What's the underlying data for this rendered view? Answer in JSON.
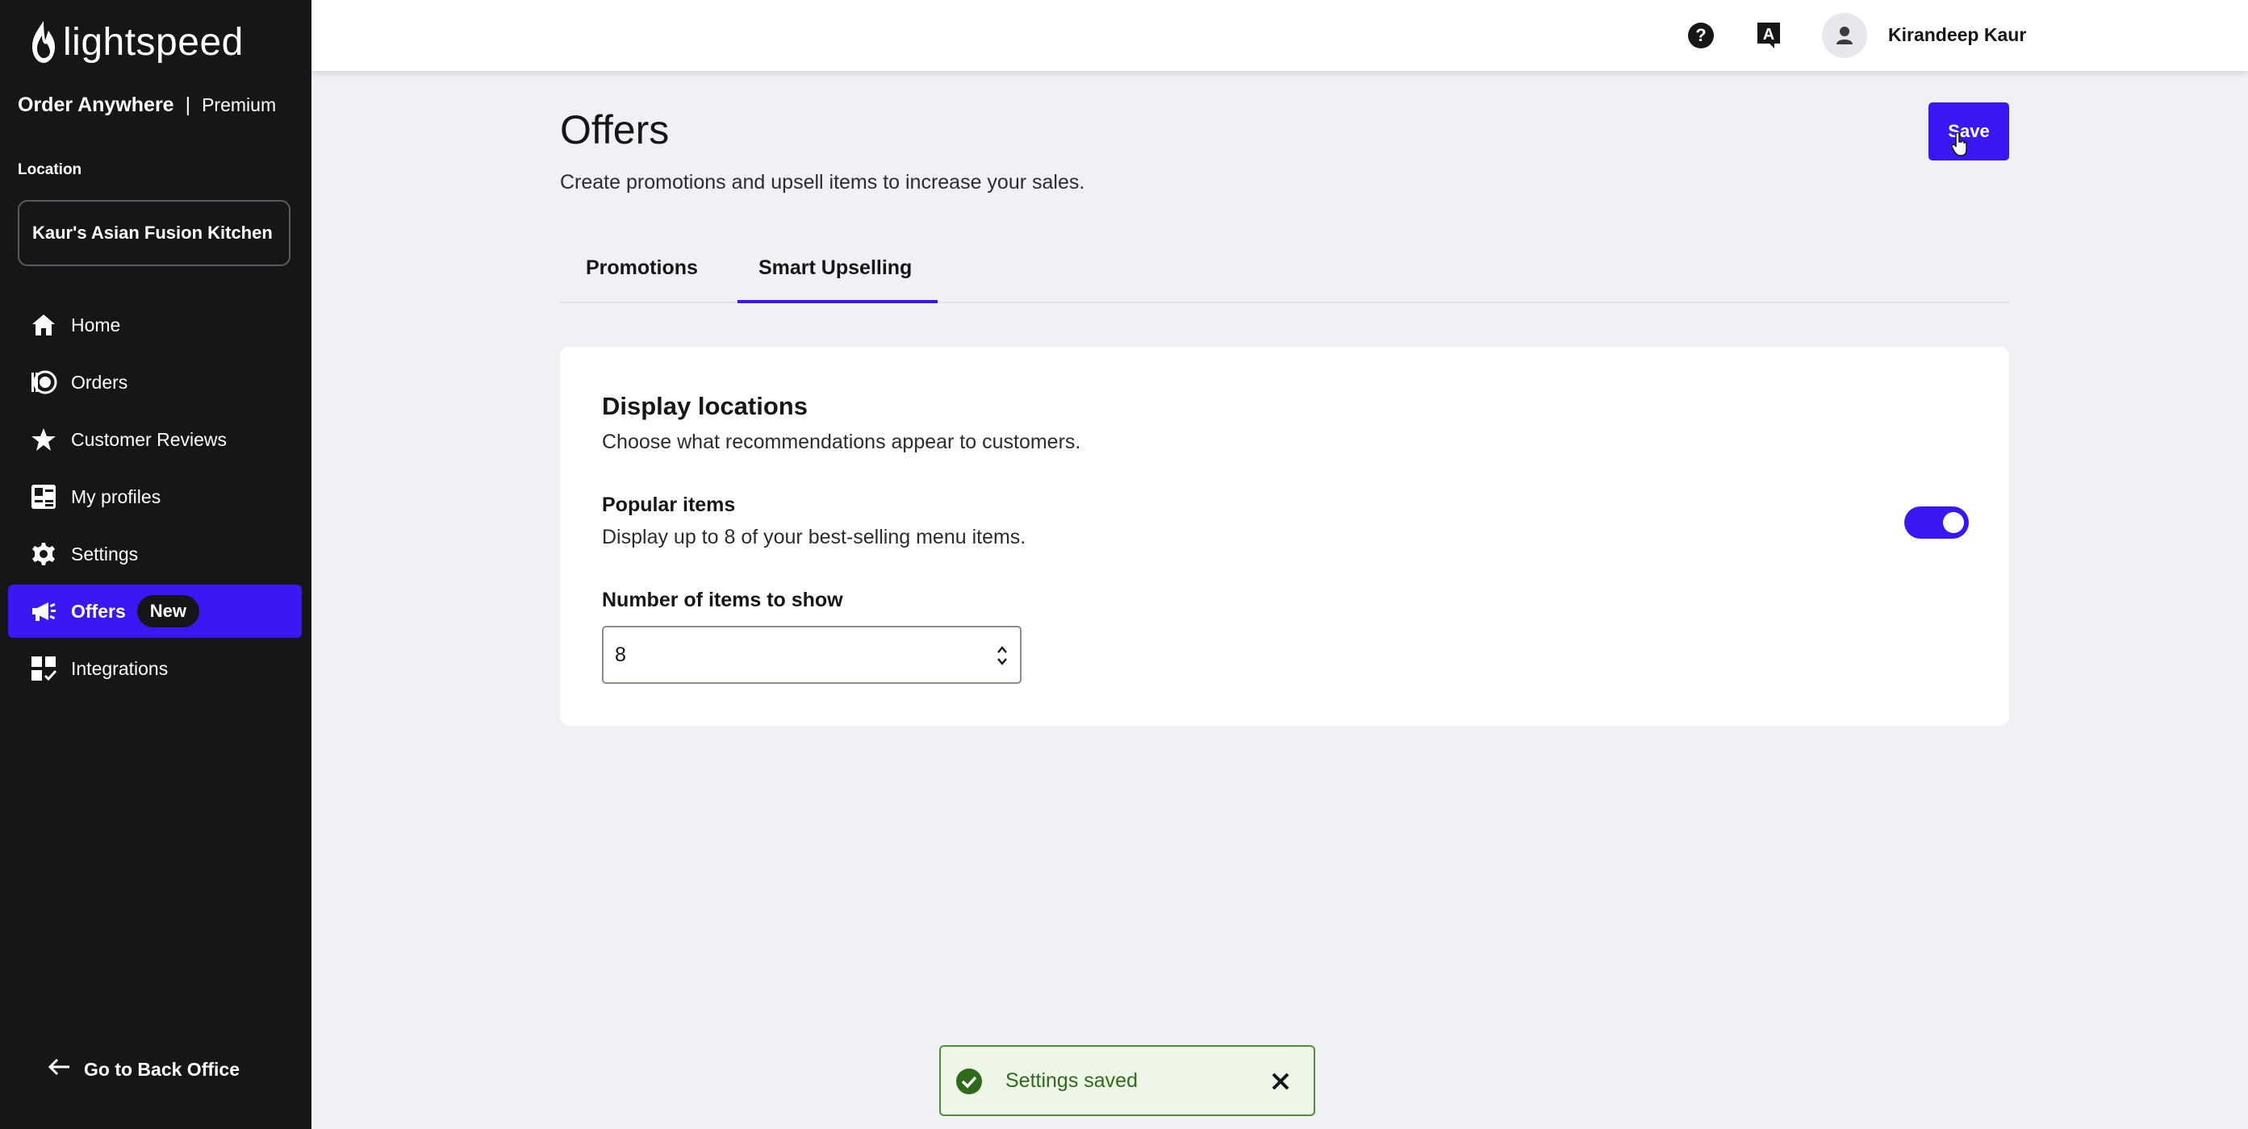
{
  "sidebar": {
    "logo_text": "lightspeed",
    "product_name": "Order Anywhere",
    "product_separator": "|",
    "product_tier": "Premium",
    "location_label": "Location",
    "location_value": "Kaur's Asian Fusion Kitchen",
    "items": [
      {
        "label": "Home",
        "icon": "home-icon"
      },
      {
        "label": "Orders",
        "icon": "orders-icon"
      },
      {
        "label": "Customer Reviews",
        "icon": "star-icon"
      },
      {
        "label": "My profiles",
        "icon": "profiles-icon"
      },
      {
        "label": "Settings",
        "icon": "gear-icon"
      },
      {
        "label": "Offers",
        "icon": "megaphone-icon",
        "badge": "New",
        "active": true
      },
      {
        "label": "Integrations",
        "icon": "integrations-icon"
      }
    ],
    "back_office": "Go to Back Office"
  },
  "topbar": {
    "user_name": "Kirandeep Kaur",
    "icons": [
      "help-icon",
      "language-icon",
      "user-icon"
    ]
  },
  "page": {
    "title": "Offers",
    "subtitle": "Create promotions and upsell items to increase your sales.",
    "save_label": "Save",
    "tabs": [
      {
        "label": "Promotions",
        "active": false
      },
      {
        "label": "Smart Upselling",
        "active": true
      }
    ]
  },
  "card": {
    "title": "Display locations",
    "description": "Choose what recommendations appear to customers.",
    "popular_title": "Popular items",
    "popular_description": "Display up to 8 of your best-selling menu items.",
    "popular_enabled": true,
    "quantity_label": "Number of items to show",
    "quantity_value": "8"
  },
  "toast": {
    "message": "Settings saved"
  },
  "colors": {
    "accent": "#3b17f5",
    "sidebar_bg": "#161618",
    "page_bg": "#eff1f5",
    "success": "#4f8f33"
  }
}
